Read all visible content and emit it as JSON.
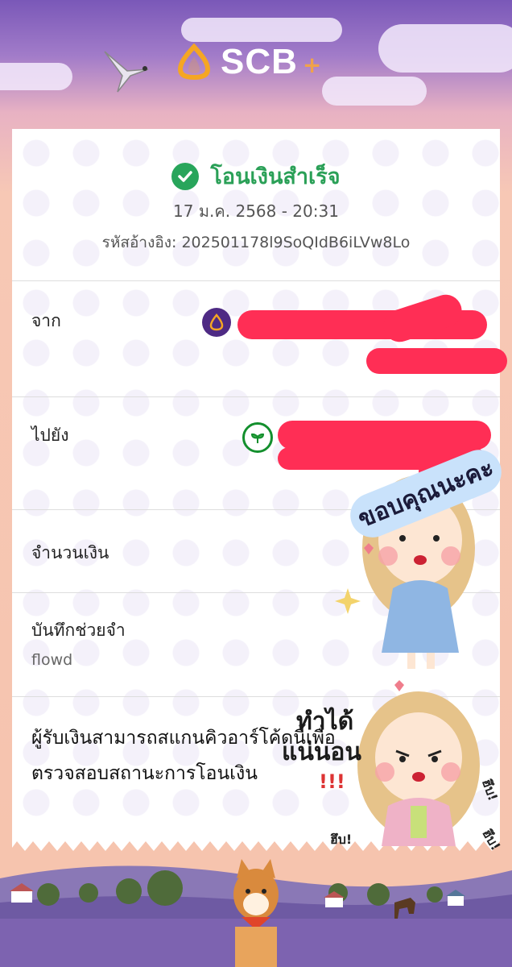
{
  "header": {
    "brand": "SCB",
    "plus": "+"
  },
  "status": {
    "text": "โอนเงินสำเร็จ"
  },
  "datetime": "17 ม.ค. 2568 - 20:31",
  "reference": {
    "label": "รหัสอ้างอิง:",
    "code": "202501178l9SoQIdB6iLVw8Lo"
  },
  "from": {
    "label": "จาก"
  },
  "to": {
    "label": "ไปยัง"
  },
  "amount": {
    "label": "จำนวนเงิน"
  },
  "memo": {
    "label": "บันทึกช่วยจำ",
    "value": "flowd"
  },
  "qr_note": {
    "line1": "ผู้รับเงินสามารถสแกนคิวอาร์โค้ดนี้เพื่อ",
    "line2": "ตรวจสอบสถานะการโอนเงิน"
  },
  "stickers": {
    "thanks": "ขอบคุณนะคะ",
    "cando": "ทำได้",
    "sure": "แน่นอน",
    "exclaim": "!!!",
    "hup1": "ฮึบ!",
    "hup2": "ฮึบ!",
    "hup3": "ฮึบ!"
  },
  "colors": {
    "scb_purple": "#4e2a84",
    "success_green": "#28a55b",
    "redaction": "#ff2e55",
    "kbank_green": "#138f2d"
  }
}
